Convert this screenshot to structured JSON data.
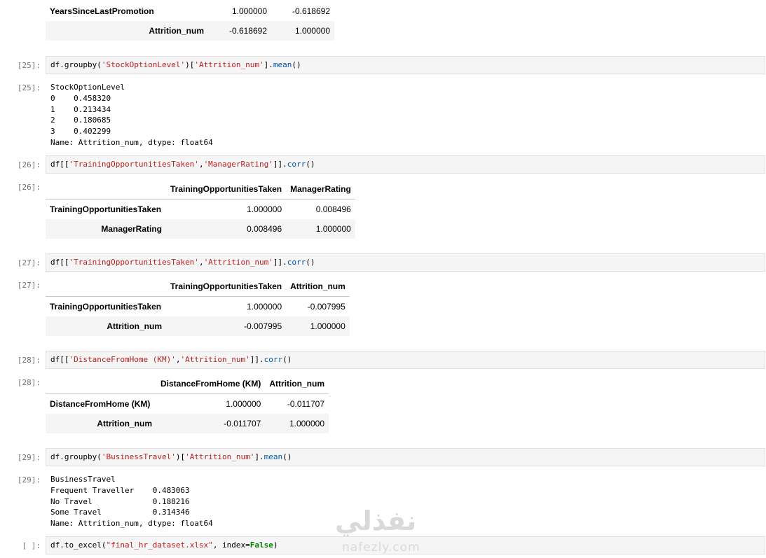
{
  "top_table": {
    "rows": [
      {
        "index": "YearsSinceLastPromotion",
        "v1": "1.000000",
        "v2": "-0.618692"
      },
      {
        "index": "Attrition_num",
        "v1": "-0.618692",
        "v2": "1.000000"
      }
    ]
  },
  "cell25": {
    "in_prompt": "[25]:",
    "out_prompt": "[25]:",
    "code": {
      "a": "df.groupby(",
      "s1": "'StockOptionLevel'",
      "b": ")[",
      "s2": "'Attrition_num'",
      "c": "].",
      "m": "mean",
      "d": "()"
    },
    "output": [
      "StockOptionLevel",
      "0    0.458320",
      "1    0.213434",
      "2    0.180685",
      "3    0.402299",
      "Name: Attrition_num, dtype: float64"
    ]
  },
  "cell26": {
    "in_prompt": "[26]:",
    "out_prompt": "[26]:",
    "code": {
      "a": "df[[",
      "s1": "'TrainingOpportunitiesTaken'",
      "b": ",",
      "s2": "'ManagerRating'",
      "c": "]].",
      "m": "corr",
      "d": "()"
    },
    "table": {
      "columns": [
        "TrainingOpportunitiesTaken",
        "ManagerRating"
      ],
      "rows": [
        {
          "index": "TrainingOpportunitiesTaken",
          "v1": "1.000000",
          "v2": "0.008496"
        },
        {
          "index": "ManagerRating",
          "v1": "0.008496",
          "v2": "1.000000"
        }
      ]
    }
  },
  "cell27": {
    "in_prompt": "[27]:",
    "out_prompt": "[27]:",
    "code": {
      "a": "df[[",
      "s1": "'TrainingOpportunitiesTaken'",
      "b": ",",
      "s2": "'Attrition_num'",
      "c": "]].",
      "m": "corr",
      "d": "()"
    },
    "table": {
      "columns": [
        "TrainingOpportunitiesTaken",
        "Attrition_num"
      ],
      "rows": [
        {
          "index": "TrainingOpportunitiesTaken",
          "v1": "1.000000",
          "v2": "-0.007995"
        },
        {
          "index": "Attrition_num",
          "v1": "-0.007995",
          "v2": "1.000000"
        }
      ]
    }
  },
  "cell28": {
    "in_prompt": "[28]:",
    "out_prompt": "[28]:",
    "code": {
      "a": "df[[",
      "s1": "'DistanceFromHome (KM)'",
      "b": ",",
      "s2": "'Attrition_num'",
      "c": "]].",
      "m": "corr",
      "d": "()"
    },
    "table": {
      "columns": [
        "DistanceFromHome (KM)",
        "Attrition_num"
      ],
      "rows": [
        {
          "index": "DistanceFromHome (KM)",
          "v1": "1.000000",
          "v2": "-0.011707"
        },
        {
          "index": "Attrition_num",
          "v1": "-0.011707",
          "v2": "1.000000"
        }
      ]
    }
  },
  "cell29": {
    "in_prompt": "[29]:",
    "out_prompt": "[29]:",
    "code": {
      "a": "df.groupby(",
      "s1": "'BusinessTravel'",
      "b": ")[",
      "s2": "'Attrition_num'",
      "c": "].",
      "m": "mean",
      "d": "()"
    },
    "output": [
      "BusinessTravel",
      "Frequent Traveller    0.483063",
      "No Travel             0.188216",
      "Some Travel           0.314346",
      "Name: Attrition_num, dtype: float64"
    ]
  },
  "cell30": {
    "in_prompt": "[ ]:",
    "code": {
      "a": "df.to_excel(",
      "s1": "\"final_hr_dataset.xlsx\"",
      "b": ", index=",
      "k": "False",
      "c": ")"
    }
  },
  "watermark": {
    "arabic": "نفذلي",
    "latin": "nafezly.com"
  }
}
